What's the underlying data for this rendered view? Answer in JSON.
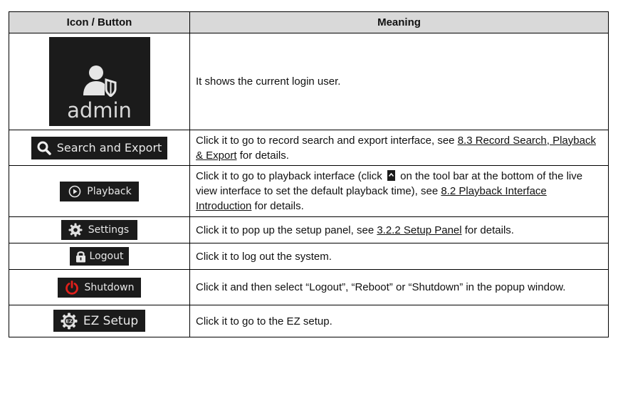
{
  "header": {
    "col_icon": "Icon / Button",
    "col_meaning": "Meaning"
  },
  "rows": [
    {
      "button_label": "admin",
      "icon": "user-shield-icon",
      "desc": "It shows the current login user."
    },
    {
      "button_label": "Search and Export",
      "icon": "search-icon",
      "desc_pre": "Click it to go to record search and export interface, see ",
      "link": "8.3 Record Search, Playback & Export",
      "desc_post": " for details."
    },
    {
      "button_label": "Playback",
      "icon": "play-circle-icon",
      "desc_pre": "Click it to go to playback interface (click ",
      "inline_icon": "caret-up-icon",
      "desc_mid": " on the tool bar at the bottom of the live view interface to set the default playback time), see ",
      "link": "8.2 Playback Interface Introduction",
      "desc_post": " for details."
    },
    {
      "button_label": "Settings",
      "icon": "gear-icon",
      "desc_pre": "Click it to pop up the setup panel, see ",
      "link": "3.2.2 Setup Panel",
      "desc_post": " for details."
    },
    {
      "button_label": "Logout",
      "icon": "lock-icon",
      "desc": "Click it to log out the system."
    },
    {
      "button_label": "Shutdown",
      "icon": "power-icon",
      "desc": "Click it and then select “Logout”, “Reboot” or “Shutdown” in the popup window."
    },
    {
      "button_label": "EZ Setup",
      "icon": "ez-gear-icon",
      "desc": "Click it to go to the EZ setup."
    }
  ],
  "colors": {
    "header_bg": "#d9d9d9",
    "button_bg": "#1b1b1b",
    "shutdown_red": "#e0201b"
  }
}
